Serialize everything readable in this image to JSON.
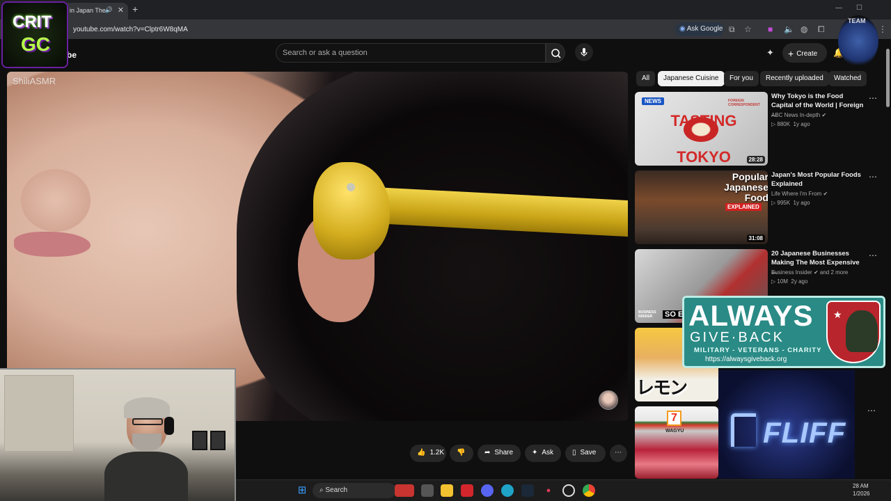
{
  "browser": {
    "tab_title": "in Japan The",
    "url": "youtube.com/watch?v=Clptr6W8qMA",
    "ask_google": "Ask Google"
  },
  "header": {
    "logo_partial": "be",
    "search_placeholder": "Search or ask a question",
    "create_label": "Create"
  },
  "video": {
    "watermark": "ShiliASMR"
  },
  "actions": {
    "likes": "1.2K",
    "share": "Share",
    "ask": "Ask",
    "save": "Save"
  },
  "chips": [
    "All",
    "Japanese Cuisine",
    "For you",
    "Recently uploaded",
    "Watched"
  ],
  "recommendations": [
    {
      "title": "Why Tokyo is the Food Capital of the World | Foreign ...",
      "channel": "ABC News In-depth",
      "views": "880K",
      "age": "1y ago",
      "duration": "28:28",
      "thumb_text": "TASTING TOKYO",
      "badge": "NEWS",
      "thumb_sub": "FOREIGN CORRESPONDENT"
    },
    {
      "title": "Japan's Most Popular Foods Explained",
      "channel": "Life Where I'm From",
      "views": "995K",
      "age": "1y ago",
      "duration": "31:08",
      "thumb_text": "Popular Japanese Food",
      "thumb_tag": "EXPLAINED"
    },
    {
      "title": "20 Japanese Businesses Making The Most Expensive ...",
      "channel": "Business Insider",
      "channel_extra": "and 2 more",
      "views": "10M",
      "age": "2y ago",
      "thumb_text": "SO EX",
      "thumb_brand": "BUSINESS INSIDER"
    },
    {
      "thumb_text": "レモン"
    },
    {
      "thumb_text": "WAGYU",
      "thumb_logo": "7"
    }
  ],
  "overlays": {
    "critgc_line1": "CRIT",
    "critgc_line2": "GC",
    "team": "TEAM",
    "agb_line1": "ALWAYS",
    "agb_line2": "GIVE·BACK",
    "agb_line3": "MILITARY - VETERANS - CHARITY",
    "agb_url": "https://alwaysgiveback.org",
    "fliff": "FLIFF"
  },
  "taskbar": {
    "search": "Search",
    "time": "28 AM",
    "date": "1/2026"
  },
  "colors": {
    "bg": "#0f0f0f",
    "chip_active": "#f1f1f1",
    "agb_teal": "#2a8a85",
    "gold": "#d3ad1e"
  }
}
